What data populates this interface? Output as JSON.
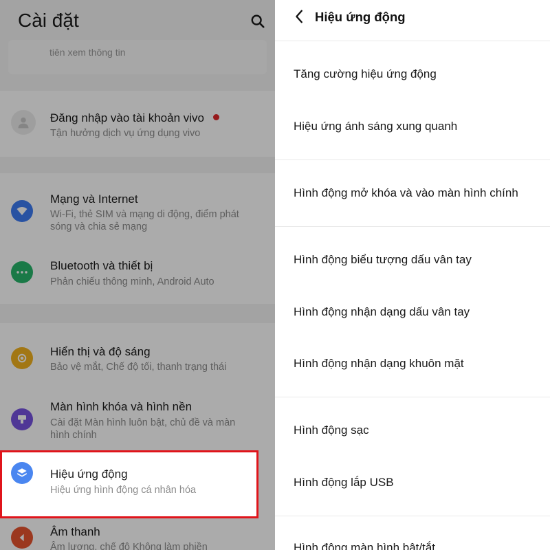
{
  "settings": {
    "title": "Cài đặt",
    "search_hint": "tiên xem thông tin",
    "account": {
      "title": "Đăng nhập vào tài khoản vivo",
      "subtitle": "Tận hưởng dịch vụ ứng dụng vivo"
    },
    "items": [
      {
        "title": "Mạng và Internet",
        "subtitle": "Wi-Fi, thẻ SIM và mạng di động, điểm phát sóng và chia sẻ mạng",
        "icon": "wifi-icon",
        "color": "#3d7bf2"
      },
      {
        "title": "Bluetooth và thiết bị",
        "subtitle": "Phản chiếu thông minh, Android Auto",
        "icon": "bluetooth-devices-icon",
        "color": "#27b56a"
      },
      {
        "title": "Hiển thị và độ sáng",
        "subtitle": "Bảo vệ mắt, Chế độ tối, thanh trạng thái",
        "icon": "brightness-icon",
        "color": "#f2b21f"
      },
      {
        "title": "Màn hình khóa và hình nền",
        "subtitle": "Cài đặt Màn hình luôn bật, chủ đề và màn hình chính",
        "icon": "wallpaper-icon",
        "color": "#7652e0"
      },
      {
        "title": "Hiệu ứng động",
        "subtitle": "Hiệu ứng hình động cá nhân hóa",
        "icon": "animation-layers-icon",
        "color": "#4a86f0"
      },
      {
        "title": "Âm thanh",
        "subtitle": "Âm lượng, chế độ Không làm phiền",
        "icon": "sound-icon",
        "color": "#e8542f"
      }
    ]
  },
  "animation": {
    "title": "Hiệu ứng động",
    "items": [
      "Tăng cường hiệu ứng động",
      "Hiệu ứng ánh sáng xung quanh",
      "Hình động mở khóa và vào màn hình chính",
      "Hình động biểu tượng dấu vân tay",
      "Hình động nhận dạng dấu vân tay",
      "Hình động nhận dạng khuôn mặt",
      "Hình động sạc",
      "Hình động lắp USB",
      "Hình động màn hình bật/tắt"
    ]
  },
  "colors": {
    "highlight": "#e0141b",
    "notification_dot": "#e0282b"
  }
}
